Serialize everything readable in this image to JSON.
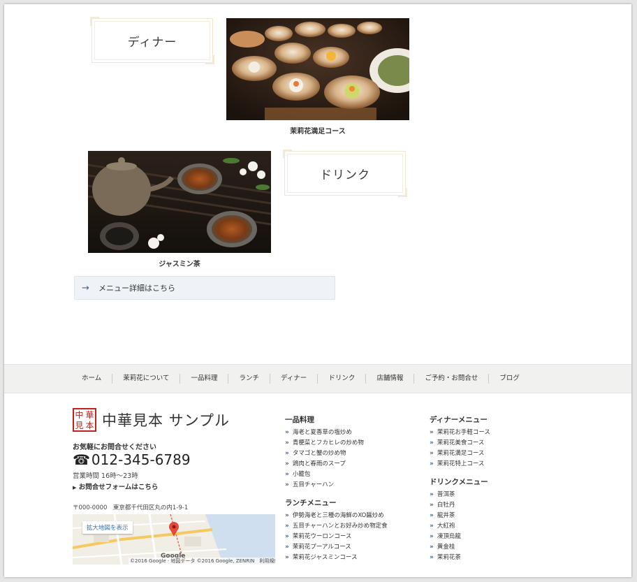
{
  "categories": {
    "dinner": {
      "label": "ディナー",
      "caption": "茉莉花満足コース"
    },
    "drink": {
      "label": "ドリンク",
      "caption": "ジャスミン茶"
    }
  },
  "more_link": {
    "label": "メニュー詳細はこちら"
  },
  "footer_nav": {
    "items": [
      "ホーム",
      "茉莉花について",
      "一品料理",
      "ランチ",
      "ディナー",
      "ドリンク",
      "店舗情報",
      "ご予約・お問合せ",
      "ブログ"
    ]
  },
  "shop": {
    "seal_chars": [
      "中",
      "華",
      "見",
      "本"
    ],
    "name": "中華見本 サンプル",
    "contact_label": "お気軽にお問合せください",
    "phone_icon": "phone-icon",
    "phone": "012-345-6789",
    "hours": "営業時間 16時〜23時",
    "form_link": "お問合せフォームはこちら",
    "address": "〒000-0000　東京都千代田区丸の内1-9-1"
  },
  "map": {
    "enlarge_label": "拡大地図を表示",
    "google_label": "Google",
    "credit": "©2016 Google · 地図データ ©2016 Google, ZENRIN　利用規約"
  },
  "menu_columns": {
    "a_la_carte": {
      "title": "一品料理",
      "items": [
        "海老と夏香草の塩炒め",
        "青梗菜とフカヒレの炒め物",
        "タマゴと蟹の炒め物",
        "鶏肉と春雨のスープ",
        "小籠包",
        "五目チャーハン"
      ]
    },
    "lunch": {
      "title": "ランチメニュー",
      "items": [
        "伊勢海老と三種の海鮮のXO醤炒め",
        "五目チャーハンとお好み炒め物定食",
        "茉莉花ウーロンコース",
        "茉莉花プーアルコース",
        "茉莉花ジャスミンコース"
      ]
    },
    "dinner": {
      "title": "ディナーメニュー",
      "items": [
        "茉莉花お手軽コース",
        "茉莉花美食コース",
        "茉莉花満足コース",
        "茉莉花特上コース"
      ]
    },
    "drink": {
      "title": "ドリンクメニュー",
      "items": [
        "普洱茶",
        "白牡丹",
        "龍井茶",
        "大紅袍",
        "凍頂烏龍",
        "黄金桂",
        "茉莉花茶"
      ]
    }
  },
  "colors": {
    "seal_red": "#c1221b",
    "nav_bg": "#f1f1ef",
    "link_arrow": "#3d5a7d",
    "button_bg": "#eff3f7"
  }
}
